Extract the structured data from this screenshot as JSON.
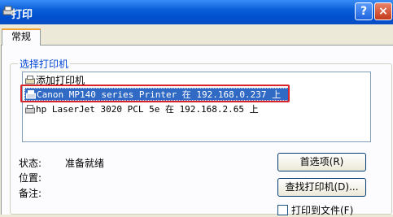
{
  "window": {
    "title": "打印",
    "help_label": "?",
    "close_label": "×"
  },
  "tabs": [
    {
      "label": "常规"
    }
  ],
  "printer_group": {
    "label": "选择打印机",
    "items": [
      {
        "label": "添加打印机"
      },
      {
        "label": "Canon MP140 series Printer 在 192.168.0.237 上",
        "selected": true
      },
      {
        "label": "hp LaserJet 3020 PCL 5e 在 192.168.2.65 上"
      }
    ],
    "status_label": "状态:",
    "status_value": "准备就绪",
    "location_label": "位置:",
    "comment_label": "备注:",
    "preferences_button": "首选项(R)",
    "find_printer_button": "查找打印机(D)...",
    "print_to_file_label": "打印到文件(F)"
  },
  "colors": {
    "selection": "#316ac5",
    "highlight_box": "#d9242a",
    "title_bar": "#0a5fd8"
  }
}
